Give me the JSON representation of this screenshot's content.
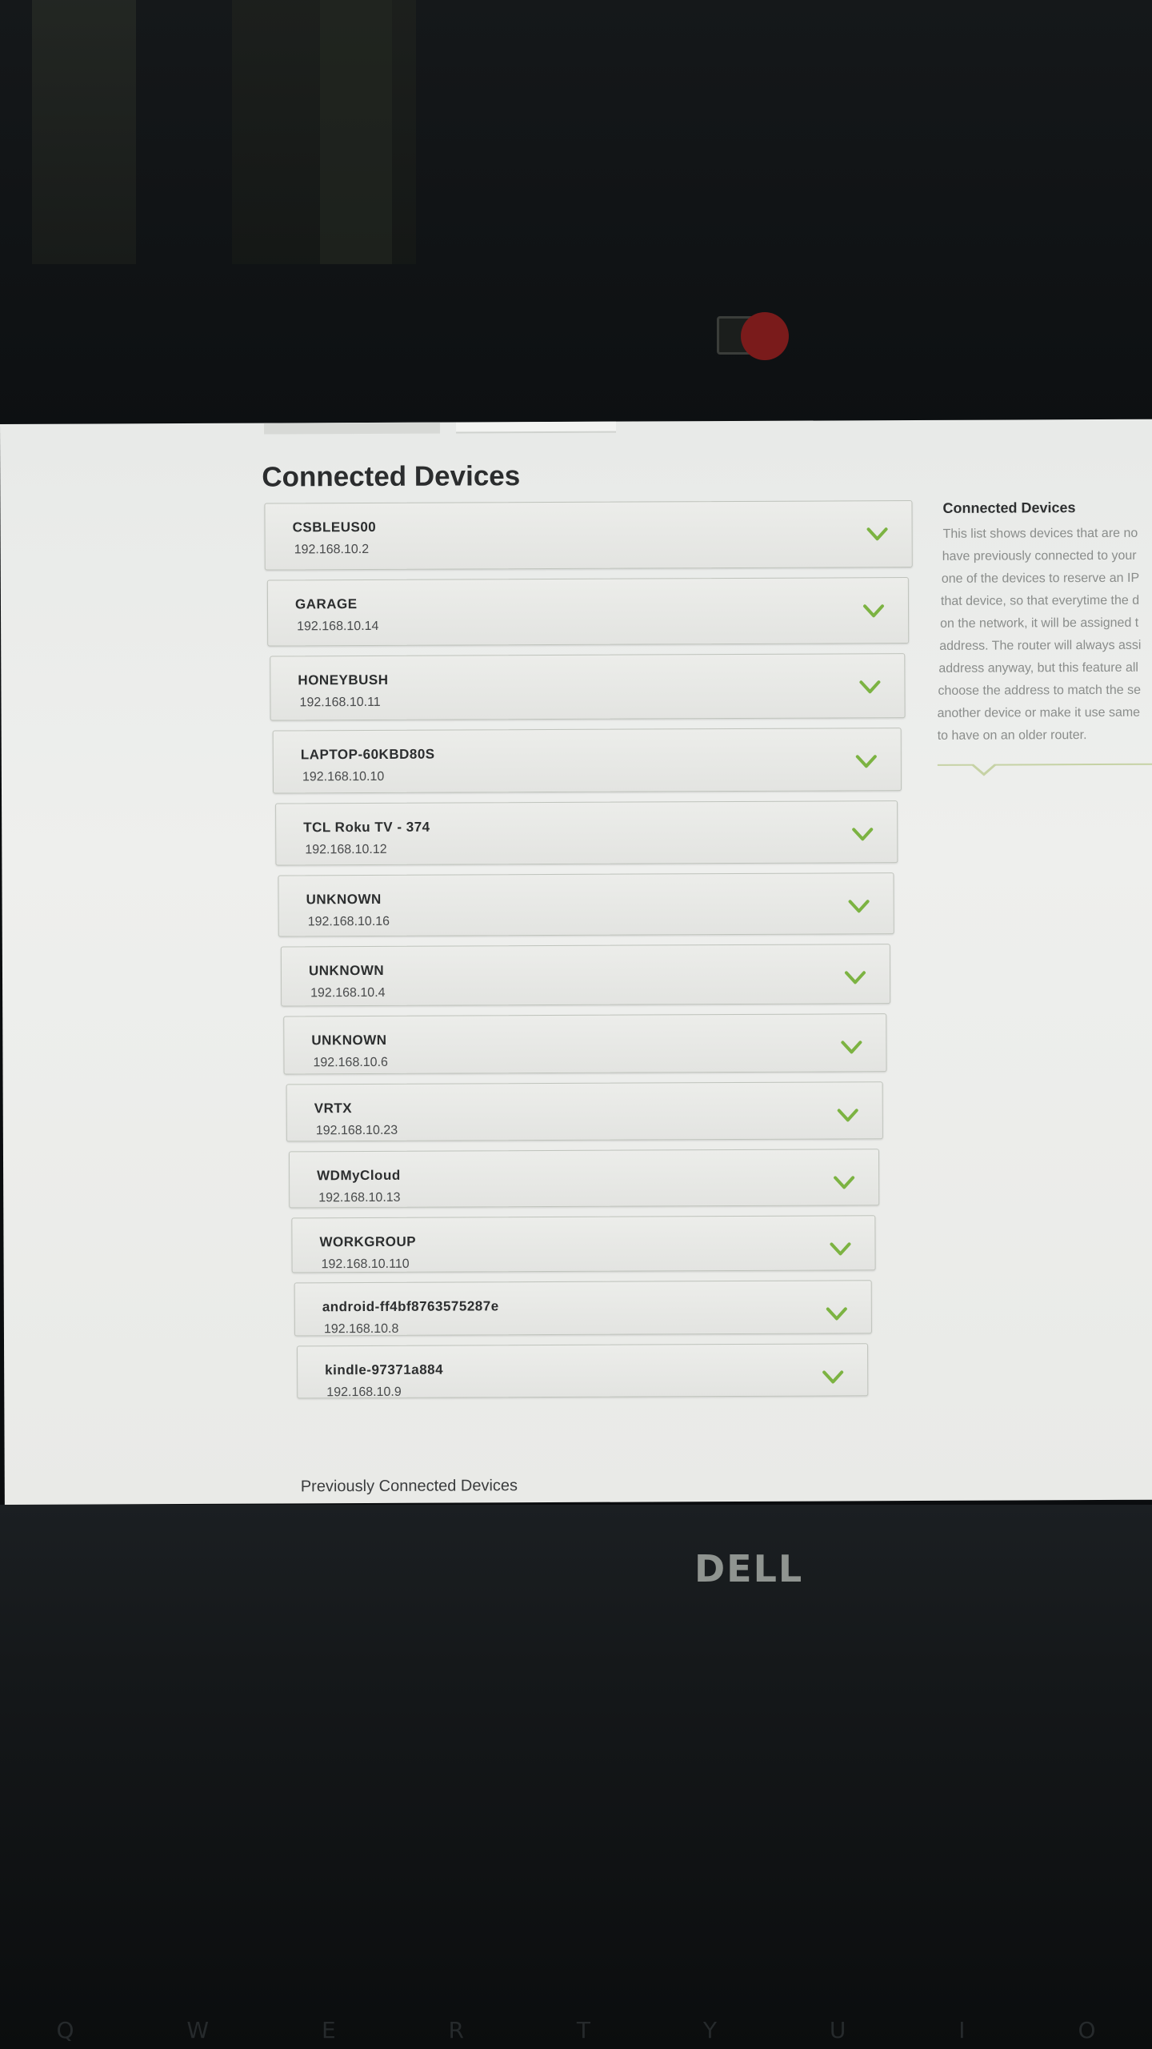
{
  "page": {
    "title": "Connected Devices",
    "previous_title": "Previously Connected Devices"
  },
  "devices": [
    {
      "name": "CSBLEUS00",
      "ip": "192.168.10.2"
    },
    {
      "name": "GARAGE",
      "ip": "192.168.10.14"
    },
    {
      "name": "HONEYBUSH",
      "ip": "192.168.10.11"
    },
    {
      "name": "LAPTOP-60KBD80S",
      "ip": "192.168.10.10"
    },
    {
      "name": "TCL Roku TV - 374",
      "ip": "192.168.10.12"
    },
    {
      "name": "UNKNOWN",
      "ip": "192.168.10.16"
    },
    {
      "name": "UNKNOWN",
      "ip": "192.168.10.4"
    },
    {
      "name": "UNKNOWN",
      "ip": "192.168.10.6"
    },
    {
      "name": "VRTX",
      "ip": "192.168.10.23"
    },
    {
      "name": "WDMyCloud",
      "ip": "192.168.10.13"
    },
    {
      "name": "WORKGROUP",
      "ip": "192.168.10.110"
    },
    {
      "name": "android-ff4bf8763575287e",
      "ip": "192.168.10.8"
    },
    {
      "name": "kindle-97371a884",
      "ip": "192.168.10.9"
    }
  ],
  "help": {
    "title": "Connected Devices",
    "lines": [
      "This list shows devices that are no",
      "have previously connected to your",
      "one of the devices to reserve an IP",
      "that device, so that everytime the d",
      "on the network, it will be assigned t",
      "address. The router will always assi",
      "address anyway, but this feature all",
      "choose the address to match the se",
      "another device or make it use same",
      "to have on an older router."
    ]
  },
  "laptop_brand": "DELL",
  "keyboard_keys": [
    "Q",
    "W",
    "E",
    "R",
    "T",
    "Y",
    "U",
    "I",
    "O"
  ],
  "colors": {
    "accent_chevron": "#7cb342",
    "screen_bg": "#eceeeb",
    "card_border": "#bfc3bc"
  },
  "icons": {
    "expand": "chevron-down-icon"
  }
}
